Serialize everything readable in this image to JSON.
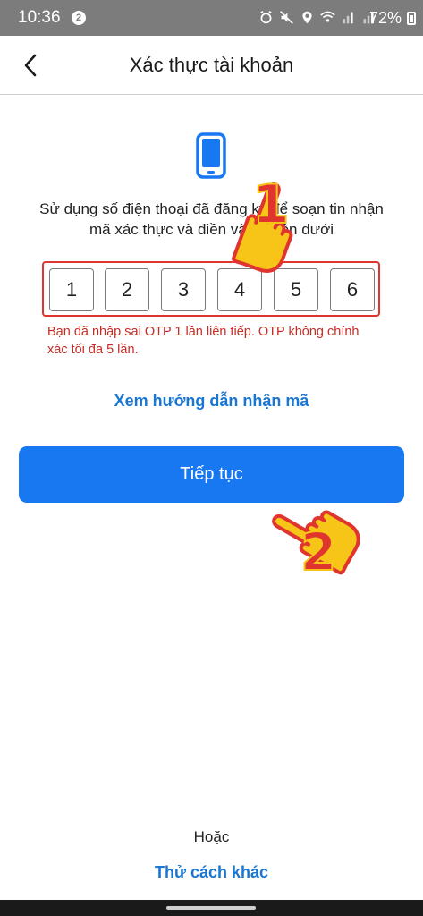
{
  "status_bar": {
    "time": "10:36",
    "notification_count": "2",
    "battery": "72%",
    "icons": [
      "alarm-icon",
      "mute-icon",
      "location-icon",
      "wifi-icon",
      "signal-icon",
      "signal-icon",
      "battery-icon"
    ]
  },
  "header": {
    "title": "Xác thực tài khoản",
    "back_icon": "chevron-left-icon"
  },
  "main": {
    "phone_icon": "smartphone-icon",
    "instruction": "Sử dụng số điện thoại đã đăng ký để soạn tin nhận mã xác thực và điền vào ô bên dưới",
    "otp_digits": [
      "1",
      "2",
      "3",
      "4",
      "5",
      "6"
    ],
    "otp_error": "Bạn đã nhập sai OTP 1 lần liên tiếp. OTP không chính xác tối đa 5 lần.",
    "guide_link": "Xem hướng dẫn nhận mã",
    "continue_button": "Tiếp tục"
  },
  "footer": {
    "or_text": "Hoặc",
    "other_method_link": "Thử cách khác"
  },
  "annotations": {
    "step1_label": "1",
    "step2_label": "2",
    "hand_icon": "pointing-hand-icon",
    "highlight_color": "#e0342f",
    "hand_color": "#f7c518"
  },
  "colors": {
    "accent": "#1778f2",
    "link": "#1976d2",
    "error": "#c62b24"
  }
}
